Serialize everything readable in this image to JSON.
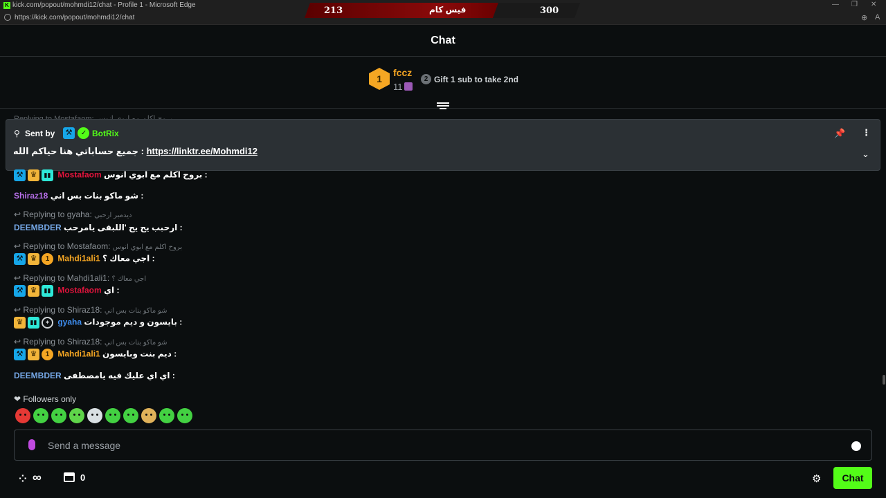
{
  "browser": {
    "window_title": "kick.com/popout/mohmdi12/chat - Profile 1 - Microsoft Edge",
    "url": "https://kick.com/popout/mohmdi12/chat",
    "favicon_letter": "K"
  },
  "overlay": {
    "left_score": "213",
    "center_text": "فيس كام",
    "right_score": "300"
  },
  "header": {
    "title": "Chat"
  },
  "leaderboard": {
    "rank": "1",
    "top_user": "fccz",
    "top_count": "11",
    "next_rank": "2",
    "gift_prompt": "Gift 1 sub to take 2nd"
  },
  "pinned": {
    "sent_by_label": "Sent by",
    "sender": "BotRix",
    "message_prefix": "جميع حساباتي هنا حياكم الله : ",
    "link": "https://linktr.ee/Mohmdi12"
  },
  "ghost_text": "Replying to Mostafaom: بروح اكلم مع ابوي انوس",
  "messages": [
    {
      "user": "Mostafaom",
      "text": "بروح اكلم مع ابوي انوس :"
    },
    {
      "user": "Shiraz18",
      "text": "شو ماكو بنات بس اني :"
    },
    {
      "reply": "Replying to gyaha:",
      "quote": "ديدمبر ارحبي",
      "user": "DEEMBDER",
      "text": "ارحبب يح يح 'اللبقى يامرحب :"
    },
    {
      "reply": "Replying to Mostafaom:",
      "quote": "بروح اكلم مع ابوي انوس",
      "user": "Mahdi1ali1",
      "text": "اجي معاك ؟ :"
    },
    {
      "reply": "Replying to Mahdi1ali1:",
      "quote": "اجي معاك ؟",
      "user": "Mostafaom",
      "text": "اي :"
    },
    {
      "reply": "Replying to Shiraz18:",
      "quote": "شو ماكو بنات بس اني",
      "user": "gyaha",
      "text": "بايسون و ديم موجودات :"
    },
    {
      "reply": "Replying to Shiraz18:",
      "quote": "شو ماكو بنات بس اني",
      "user": "Mahdi1ali1",
      "text": "ديم بنت وبايسون :"
    },
    {
      "user": "DEEMBDER",
      "text": "اي اي عليك فيه يامصطفى :"
    }
  ],
  "followers_only_label": "Followers only",
  "emote_colors": [
    "#e53935",
    "#43d142",
    "#43d142",
    "#5fd54a",
    "#d9e0e3",
    "#43d142",
    "#43d142",
    "#e0b25a",
    "#43d142",
    "#43d142"
  ],
  "input": {
    "placeholder": "Send a message"
  },
  "bottom": {
    "points_value": "∞",
    "store_count": "0",
    "chat_button": "Chat"
  },
  "colors": {
    "brand_green": "#53fc18",
    "background": "#0b0e0f",
    "pinned_bg": "#2b3034"
  }
}
